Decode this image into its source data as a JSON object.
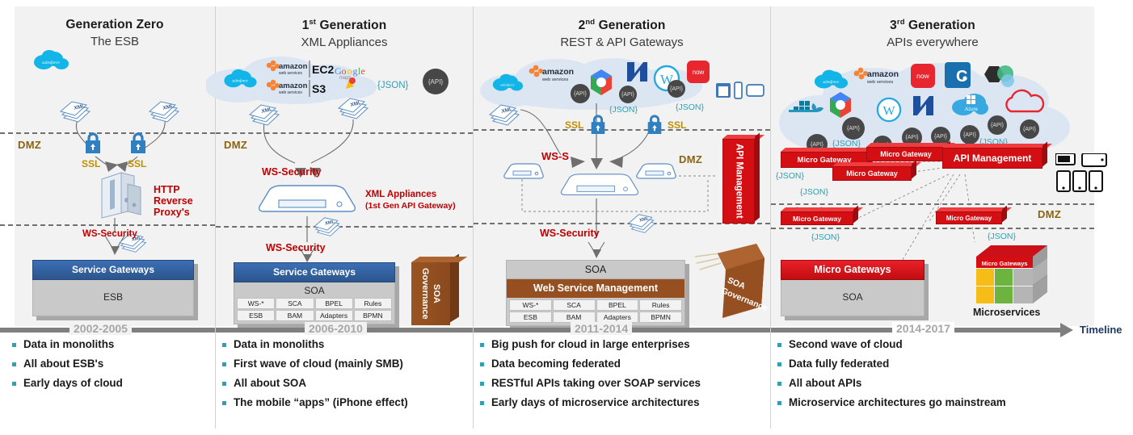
{
  "timeline_label": "Timeline",
  "panels": [
    {
      "id": "generation-zero",
      "title": "Generation Zero",
      "title_sup": "",
      "subtitle": "The ESB",
      "years": "2002-2005",
      "dmz_label": "DMZ",
      "dmz_label_2": "",
      "labels": {
        "ssl_left": "SSL",
        "ssl_right": "SSL",
        "http_proxy": "HTTP\nReverse\nProxy's",
        "ws_security": "WS-Security"
      },
      "cloud_logos": [
        "salesforce"
      ],
      "gateway": {
        "cap": "Service Gateways",
        "body": "ESB"
      },
      "bullets": [
        "Data in monoliths",
        "All about ESB's",
        "Early days of cloud"
      ]
    },
    {
      "id": "first-generation",
      "title": "1",
      "title_sup": "st",
      "title_rest": " Generation",
      "subtitle": "XML Appliances",
      "years": "2006-2010",
      "dmz_label": "DMZ",
      "labels": {
        "json": "{JSON}",
        "api": "{API}",
        "ws_security_top": "WS-Security",
        "ws_security_bottom": "WS-Security",
        "appliance_line1": "XML Appliances",
        "appliance_line2": "(1st Gen API Gateway)"
      },
      "cloud_logos": [
        "salesforce",
        "amazon web services EC2",
        "Google maps",
        "amazon web services S3"
      ],
      "gateway": {
        "cap": "Service Gateways",
        "body": "SOA"
      },
      "soa_grid": [
        [
          "WS-*",
          "SCA",
          "BPEL",
          "Rules"
        ],
        [
          "ESB",
          "BAM",
          "Adapters",
          "BPMN"
        ]
      ],
      "governance": "SOA Governance",
      "bullets": [
        "Data in monoliths",
        "First wave of cloud (mainly SMB)",
        "All about SOA",
        "The mobile “apps” (iPhone effect)"
      ]
    },
    {
      "id": "second-generation",
      "title": "2",
      "title_sup": "nd",
      "title_rest": " Generation",
      "subtitle": "REST & API Gateways",
      "years": "2011-2014",
      "dmz_label": "DMZ",
      "labels": {
        "json_left": "{JSON}",
        "json_right": "{JSON}",
        "ssl_left": "SSL",
        "ssl_right": "SSL",
        "ws_s": "WS-S",
        "ws_security": "WS-Security",
        "api_management": "API Management"
      },
      "cloud_logos": [
        "salesforce",
        "amazon web services",
        "google cloud",
        "netsuite",
        "workday",
        "now"
      ],
      "gateway": {
        "cap": "SOA",
        "body": "Web Service Management"
      },
      "soa_grid": [
        [
          "WS-*",
          "SCA",
          "BPEL",
          "Rules"
        ],
        [
          "ESB",
          "BAM",
          "Adapters",
          "BPMN"
        ]
      ],
      "governance": "SOA Governance",
      "bullets": [
        "Big push for cloud in large enterprises",
        "Data becoming federated",
        "RESTful APIs taking over SOAP services",
        "Early days of microservice architectures"
      ]
    },
    {
      "id": "third-generation",
      "title": "3",
      "title_sup": "rd",
      "title_rest": " Generation",
      "subtitle": "APIs everywhere",
      "years": "2014-2017",
      "dmz_label": "DMZ",
      "labels": {
        "api_management": "API Management",
        "micro_gateway": "Micro Gateway",
        "micro_gateways": "Micro Gateways",
        "microservices": "Microservices",
        "json": "{JSON}"
      },
      "cloud_logos": [
        "salesforce",
        "amazon web services",
        "now",
        "C.",
        "mongodb",
        "docker",
        "google cloud",
        "workday",
        "netsuite",
        "Azure",
        "red cloud"
      ],
      "gateway": {
        "cap": "Micro Gateways",
        "body": "SOA"
      },
      "bullets": [
        "Second wave of cloud",
        "Data fully federated",
        "All about APIs",
        "Microservice architectures go mainstream"
      ]
    }
  ],
  "api_bubble_text": "{API}",
  "json_text": "{JSON}",
  "colors": {
    "red": "#d40f14",
    "brown": "#954f20",
    "blue_cap": "#2e5f9e",
    "teal_json": "#2f9fb5",
    "gold": "#bf8f00",
    "dark_red_text": "#c00000",
    "timeline_gray": "#7f7f7f"
  }
}
